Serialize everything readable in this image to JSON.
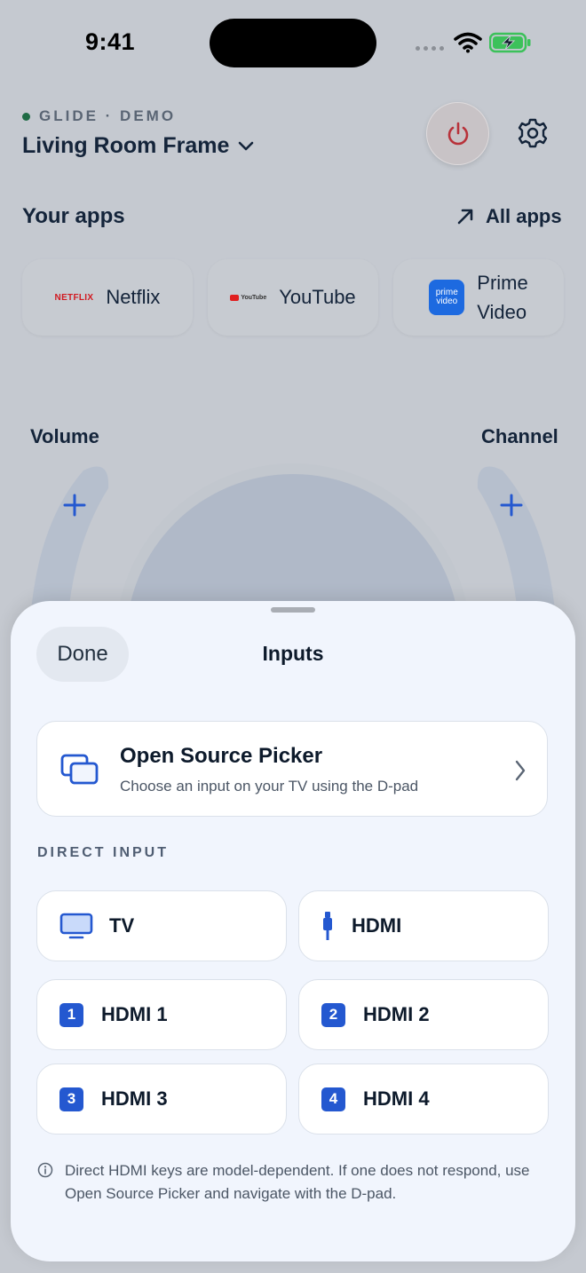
{
  "status_bar": {
    "time": "9:41"
  },
  "header": {
    "brand": "GLIDE · DEMO",
    "device_name": "Living Room Frame",
    "colors": {
      "brand_dot": "#1f6b45",
      "power_icon": "#b8323a"
    }
  },
  "apps": {
    "title": "Your apps",
    "all_apps_label": "All apps",
    "items": [
      {
        "label": "Netflix",
        "logo_text": "NETFLIX"
      },
      {
        "label": "YouTube",
        "logo_text": "YouTube"
      },
      {
        "label": "Prime Video",
        "label_line1": "Prime",
        "label_line2": "Video",
        "logo_text_1": "prime",
        "logo_text_2": "video"
      }
    ]
  },
  "remote": {
    "volume_label": "Volume",
    "channel_label": "Channel"
  },
  "sheet": {
    "done_label": "Done",
    "title": "Inputs",
    "picker": {
      "title": "Open Source Picker",
      "subtitle": "Choose an input on your TV using the D-pad"
    },
    "section_label": "DIRECT INPUT",
    "inputs": [
      {
        "label": "TV",
        "icon": "tv-icon"
      },
      {
        "label": "HDMI",
        "icon": "hdmi-plug-icon"
      },
      {
        "label": "HDMI 1",
        "badge": "1"
      },
      {
        "label": "HDMI 2",
        "badge": "2"
      },
      {
        "label": "HDMI 3",
        "badge": "3"
      },
      {
        "label": "HDMI 4",
        "badge": "4"
      }
    ],
    "note": "Direct HDMI keys are model-dependent. If one does not respond, use Open Source Picker and navigate with the D-pad.",
    "colors": {
      "accent": "#2458d0"
    }
  }
}
